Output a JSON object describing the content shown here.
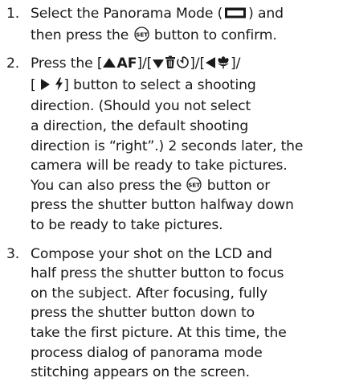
{
  "steps": [
    {
      "number": "1.",
      "line1_a": "Select the Panorama Mode (",
      "panorama_icon": "panorama-mode-icon",
      "line1_b": ") and",
      "line2_a": "then press the",
      "set_button_label": "SET",
      "line2_b": "button to confirm."
    },
    {
      "number": "2.",
      "l1_a": "Press the [",
      "af_label": "AF",
      "l1_b": "]/[",
      "l1_c": "]/[",
      "l1_d": "]/",
      "l2_a": "[",
      "l2_b": "] button to select a shooting",
      "l3": "direction. (Should you not select",
      "l4": "a direction, the default shooting",
      "l5": "direction is “right”.) 2 seconds later, the",
      "l6": "camera will be ready to take pictures.",
      "l7_a": "You can also press the",
      "set_button_label": "SET",
      "l7_b": "button or",
      "l8": "press the shutter button halfway down",
      "l9": "to be ready to take pictures."
    },
    {
      "number": "3.",
      "l1": "Compose your shot on the LCD and",
      "l2": "half press the shutter button to focus",
      "l3": "on the subject. After focusing, fully",
      "l4": "press the shutter button down to",
      "l5": "take the first picture. At this time, the",
      "l6": "process dialog of panorama mode",
      "l7": "stitching appears on the screen."
    }
  ],
  "icons": {
    "panorama": "panorama-mode-icon",
    "set_button": "set-button-icon",
    "up": "up-arrow-icon",
    "down": "down-arrow-icon",
    "left": "left-arrow-icon",
    "right": "right-arrow-icon",
    "self_timer": "self-timer-icon",
    "macro": "macro-flower-icon",
    "flash": "flash-icon",
    "delete": "trash-icon"
  }
}
